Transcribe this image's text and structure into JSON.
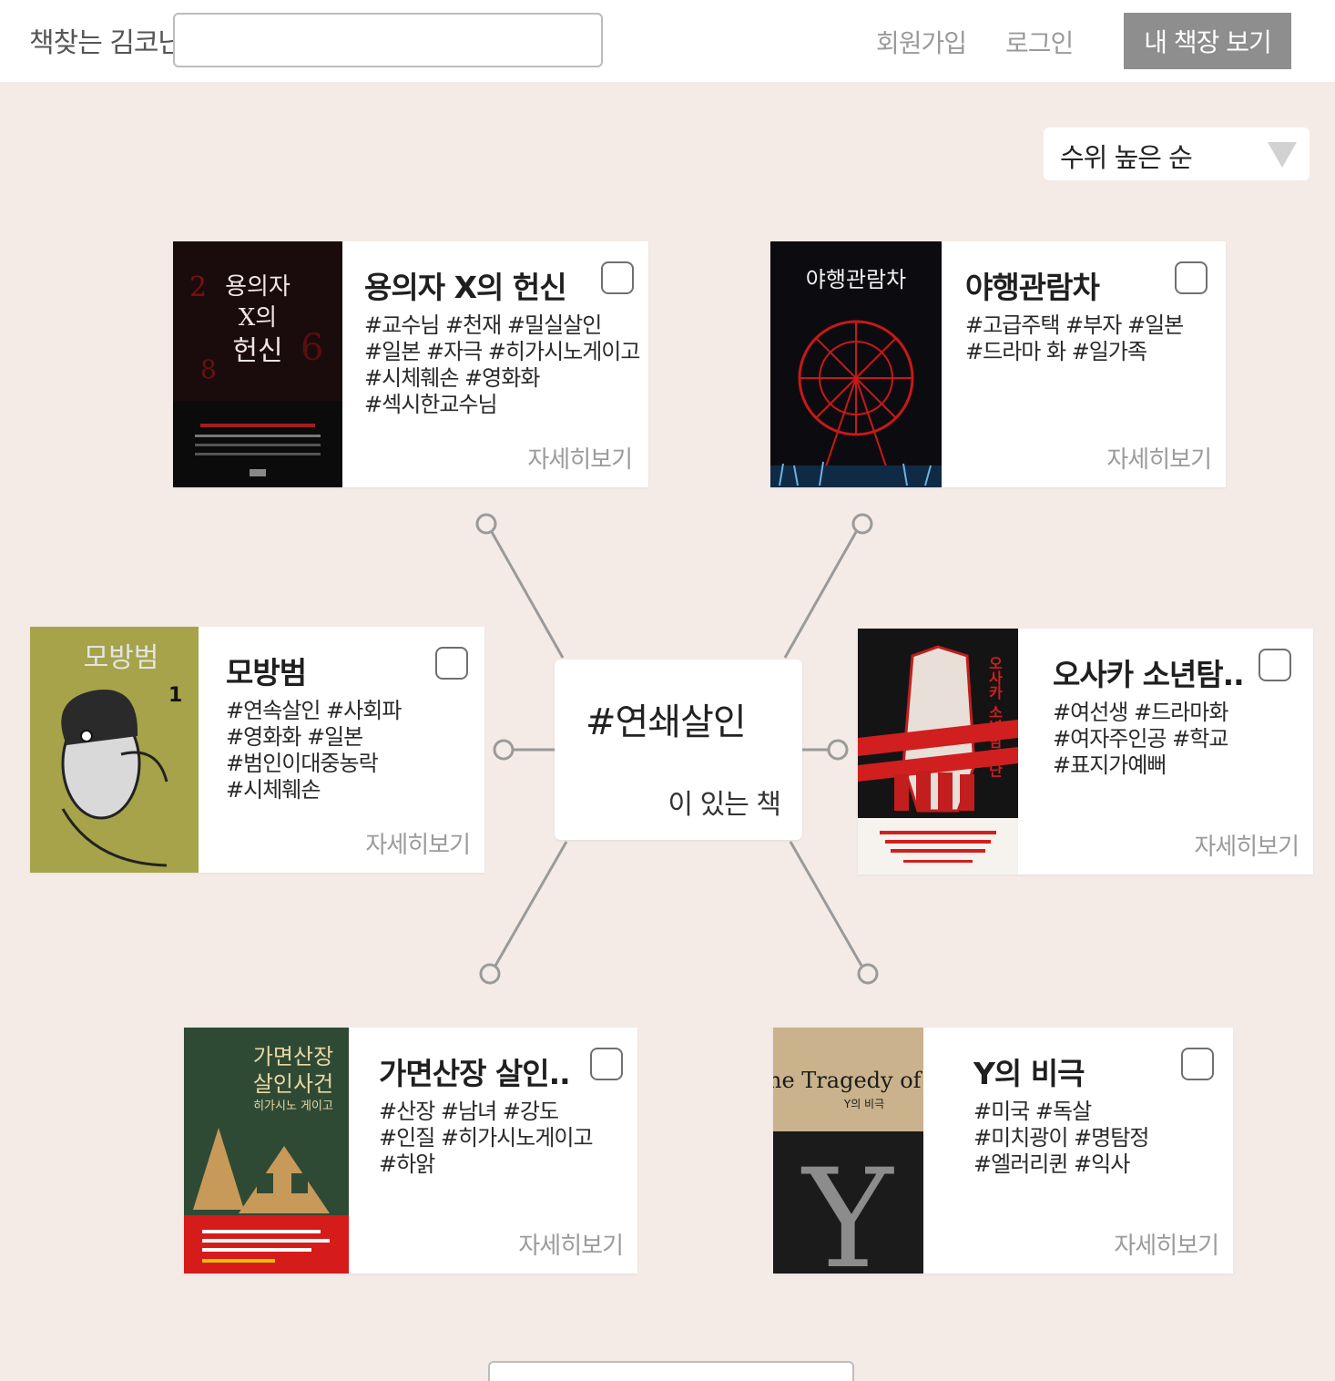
{
  "header": {
    "brand": "책찾는 김코난",
    "search_placeholder": "",
    "signup_label": "회원가입",
    "login_label": "로그인",
    "my_shelf_label": "내 책장 보기"
  },
  "sort": {
    "selected": "수위 높은 순"
  },
  "hub": {
    "tag": "#연쇄살인",
    "subtitle": "이 있는 책"
  },
  "books": [
    {
      "title": "용의자 X의 헌신",
      "tags": [
        "#교수님 #천재 #밀실살인",
        "#일본 #자극 #히가시노게이고",
        "#시체훼손 #영화화",
        "#섹시한교수님"
      ],
      "more_label": "자세히보기",
      "cover_text": [
        "용의자",
        "X의",
        "헌신"
      ],
      "cover_color": "#1a0c0c"
    },
    {
      "title": "야행관람차",
      "tags": [
        "#고급주택 #부자 #일본",
        "#드라마 화 #일가족"
      ],
      "more_label": "자세히보기",
      "cover_text": [
        "야행관람차"
      ],
      "cover_color": "#0c0c10"
    },
    {
      "title": "모방범",
      "tags": [
        "#연속살인 #사회파",
        "#영화화 #일본",
        "#범인이대중농락",
        "#시체훼손"
      ],
      "more_label": "자세히보기",
      "cover_text": [
        "모방범",
        "1"
      ],
      "cover_color": "#a6a34a"
    },
    {
      "title": "오사카 소년탐..",
      "tags": [
        "#여선생 #드라마화",
        "#여자주인공 #학교",
        "#표지가예뻐"
      ],
      "more_label": "자세히보기",
      "cover_text": [
        "오사카 소년탐정단"
      ],
      "cover_color": "#141414"
    },
    {
      "title": "가면산장 살인..",
      "tags": [
        "#산장 #남녀 #강도",
        "#인질 #히가시노게이고",
        "#하앍"
      ],
      "more_label": "자세히보기",
      "cover_text": [
        "가면산장",
        "살인사건",
        "히가시노 게이고"
      ],
      "cover_color": "#2f4a34"
    },
    {
      "title": "Y의 비극",
      "tags": [
        "#미국 #독살",
        "#미치광이 #명탐정",
        "#엘러리퀸 #익사"
      ],
      "more_label": "자세히보기",
      "cover_text": [
        "The Tragedy of Y",
        "Y의 비극",
        "Y"
      ],
      "cover_color": "#1b1b1b"
    }
  ]
}
